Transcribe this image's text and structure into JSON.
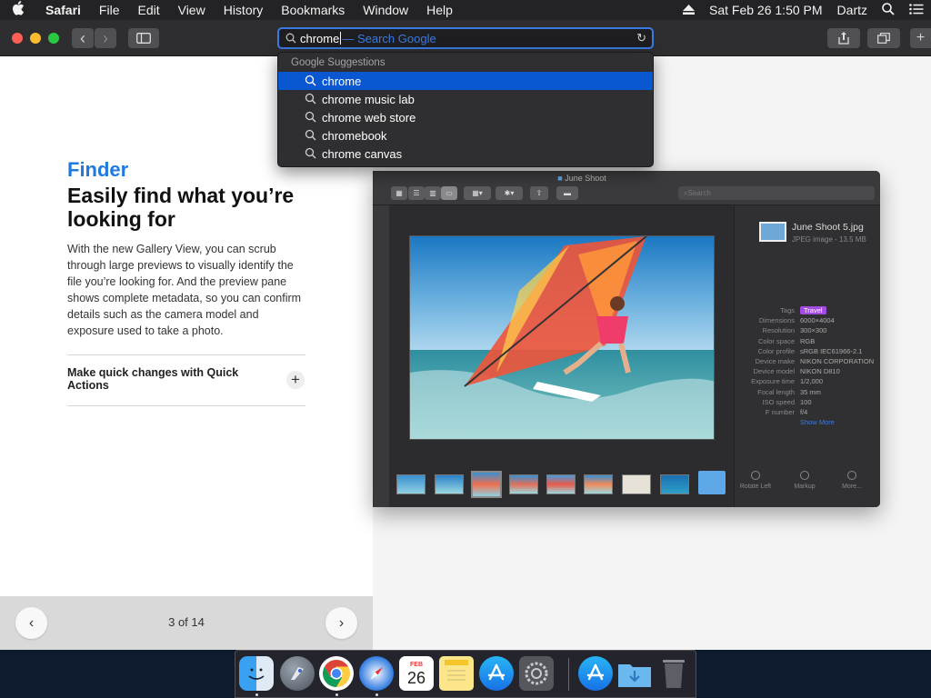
{
  "menubar": {
    "apple": "",
    "items": [
      "Safari",
      "File",
      "Edit",
      "View",
      "History",
      "Bookmarks",
      "Window",
      "Help"
    ],
    "datetime": "Sat Feb 26  1:50 PM",
    "user": "Dartz"
  },
  "toolbar": {
    "back_icon": "‹",
    "forward_icon": "›",
    "typed_query": "chrome",
    "autocomplete_hint": " — Search Google",
    "reload_icon": "↻",
    "share_icon": "⇧",
    "tabs_icon": "⧉",
    "new_tab_icon": "+"
  },
  "suggestions": {
    "header": "Google Suggestions",
    "items": [
      "chrome",
      "chrome music lab",
      "chrome web store",
      "chromebook",
      "chrome canvas"
    ]
  },
  "page": {
    "eyebrow": "Finder",
    "headline": "Easily find what you’re looking for",
    "body": "With the new Gallery View, you can scrub through large previews to visually identify the file you’re looking for. And the preview pane shows complete metadata, so you can confirm details such as the camera model and exposure used to take a photo.",
    "accordion_title": "Make quick changes with Quick Actions",
    "accordion_icon": "+",
    "pager_prev": "‹",
    "pager_next": "›",
    "pager_count": "3 of 14"
  },
  "finder": {
    "title": "June Shoot",
    "search_placeholder": "Search",
    "file_name": "June Shoot 5.jpg",
    "file_kind": "JPEG image - 13.5 MB",
    "metadata": [
      {
        "k": "Tags",
        "v": "Travel"
      },
      {
        "k": "Dimensions",
        "v": "6000×4004"
      },
      {
        "k": "Resolution",
        "v": "300×300"
      },
      {
        "k": "Color space",
        "v": "RGB"
      },
      {
        "k": "Color profile",
        "v": "sRGB IEC61966-2.1"
      },
      {
        "k": "Device make",
        "v": "NIKON CORPORATION"
      },
      {
        "k": "Device model",
        "v": "NIKON D810"
      },
      {
        "k": "Exposure time",
        "v": "1/2,000"
      },
      {
        "k": "Focal length",
        "v": "35 mm"
      },
      {
        "k": "ISO speed",
        "v": "100"
      },
      {
        "k": "F number",
        "v": "f/4"
      }
    ],
    "show_more": "Show More",
    "actions": [
      "Rotate Left",
      "Markup",
      "More..."
    ]
  },
  "dock": {
    "calendar_day": "26",
    "calendar_month": "FEB"
  },
  "colors": {
    "accent": "#1f7ae0",
    "selection": "#0a57d2",
    "tag": "#a64be2"
  }
}
